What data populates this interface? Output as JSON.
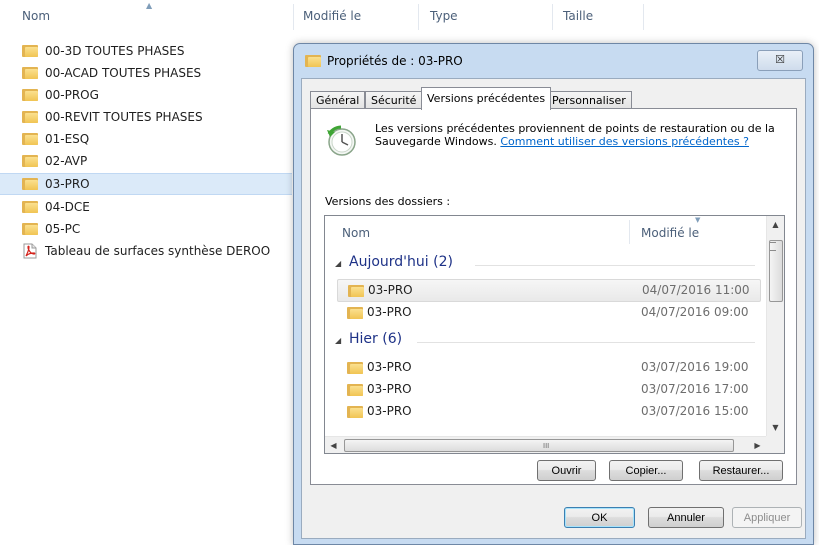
{
  "explorer": {
    "columns": {
      "name": "Nom",
      "modified": "Modifié le",
      "type": "Type",
      "size": "Taille"
    },
    "files": [
      {
        "name": "00-3D TOUTES PHASES",
        "icon": "folder-icon"
      },
      {
        "name": "00-ACAD TOUTES PHASES",
        "icon": "folder-icon"
      },
      {
        "name": "00-PROG",
        "icon": "folder-icon"
      },
      {
        "name": "00-REVIT TOUTES PHASES",
        "icon": "folder-icon"
      },
      {
        "name": "01-ESQ",
        "icon": "folder-icon"
      },
      {
        "name": "02-AVP",
        "icon": "folder-icon"
      },
      {
        "name": "03-PRO",
        "icon": "folder-icon",
        "selected": true
      },
      {
        "name": "04-DCE",
        "icon": "folder-icon"
      },
      {
        "name": "05-PC",
        "icon": "folder-icon"
      },
      {
        "name": "Tableau de surfaces synthèse DEROO",
        "icon": "pdf-icon"
      }
    ]
  },
  "dialog": {
    "title": "Propriétés de : 03-PRO",
    "close_label": "☒",
    "tabs": [
      "Général",
      "Sécurité",
      "Versions précédentes",
      "Personnaliser"
    ],
    "active_tab": "Versions précédentes",
    "info_text": "Les versions précédentes proviennent de points de restauration ou de la Sauvegarde Windows.",
    "info_link": "Comment utiliser des versions précédentes ?",
    "versions_label": "Versions des dossiers :",
    "list": {
      "col_name": "Nom",
      "col_modified": "Modifié le",
      "groups": [
        {
          "label": "Aujourd'hui (2)",
          "items": [
            {
              "name": "03-PRO",
              "date": "04/07/2016 11:00",
              "selected": true
            },
            {
              "name": "03-PRO",
              "date": "04/07/2016 09:00"
            }
          ]
        },
        {
          "label": "Hier (6)",
          "items": [
            {
              "name": "03-PRO",
              "date": "03/07/2016 19:00"
            },
            {
              "name": "03-PRO",
              "date": "03/07/2016 17:00"
            },
            {
              "name": "03-PRO",
              "date": "03/07/2016 15:00"
            }
          ]
        }
      ],
      "hscroll_grip": "III"
    },
    "buttons": {
      "open": "Ouvrir",
      "copy": "Copier...",
      "restore": "Restaurer..."
    },
    "footer": {
      "ok": "OK",
      "cancel": "Annuler",
      "apply": "Appliquer"
    },
    "colors": {
      "title_bg": "#c7dbf1",
      "link": "#0066cc",
      "group_header": "#1e3287"
    }
  }
}
